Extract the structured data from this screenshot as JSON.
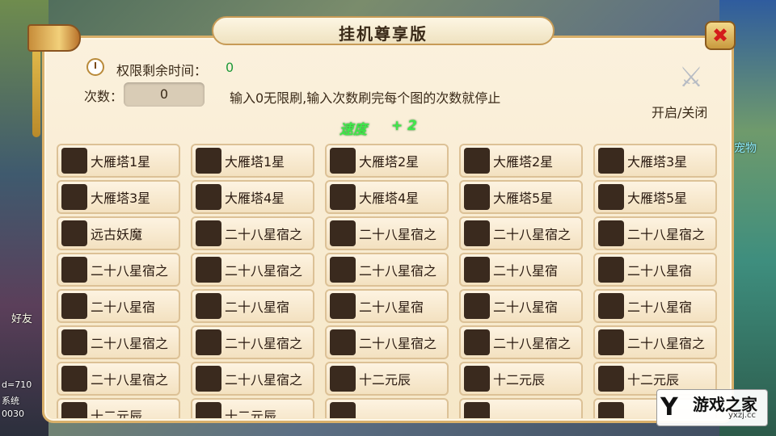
{
  "window": {
    "title": "挂机尊享版",
    "close_glyph": "✖"
  },
  "status": {
    "time_label": "权限剩余时间：",
    "time_value": "0",
    "count_label": "次数：",
    "count_value": "0",
    "hint": "输入0无限刷,输入次数刷完每个图的次数就停止",
    "toggle_label": "开启/关闭",
    "speed_label": "速度",
    "speed_value": "+ 2"
  },
  "stages": [
    [
      "大雁塔1星",
      "大雁塔1星",
      "大雁塔2星",
      "大雁塔2星",
      "大雁塔3星"
    ],
    [
      "大雁塔3星",
      "大雁塔4星",
      "大雁塔4星",
      "大雁塔5星",
      "大雁塔5星"
    ],
    [
      "远古妖魔",
      "二十八星宿之",
      "二十八星宿之",
      "二十八星宿之",
      "二十八星宿之"
    ],
    [
      "二十八星宿之",
      "二十八星宿之",
      "二十八星宿之",
      "二十八星宿",
      "二十八星宿"
    ],
    [
      "二十八星宿",
      "二十八星宿",
      "二十八星宿",
      "二十八星宿",
      "二十八星宿"
    ],
    [
      "二十八星宿之",
      "二十八星宿之",
      "二十八星宿之",
      "二十八星宿之",
      "二十八星宿之"
    ],
    [
      "二十八星宿之",
      "二十八星宿之",
      "十二元辰",
      "十二元辰",
      "十二元辰"
    ],
    [
      "十二元辰",
      "十二元辰",
      "",
      "",
      ""
    ]
  ],
  "background": {
    "left_texts": [
      "好友",
      "系统",
      "d=710",
      "0030"
    ],
    "right_text": "宠物"
  },
  "watermark": {
    "logo": "Y",
    "name": "游戏之家",
    "url": "yxzj.cc"
  },
  "icons": {
    "clock": "clock-icon",
    "swords": "crossed-swords-icon",
    "horn": "horn-icon",
    "close": "close-icon"
  }
}
